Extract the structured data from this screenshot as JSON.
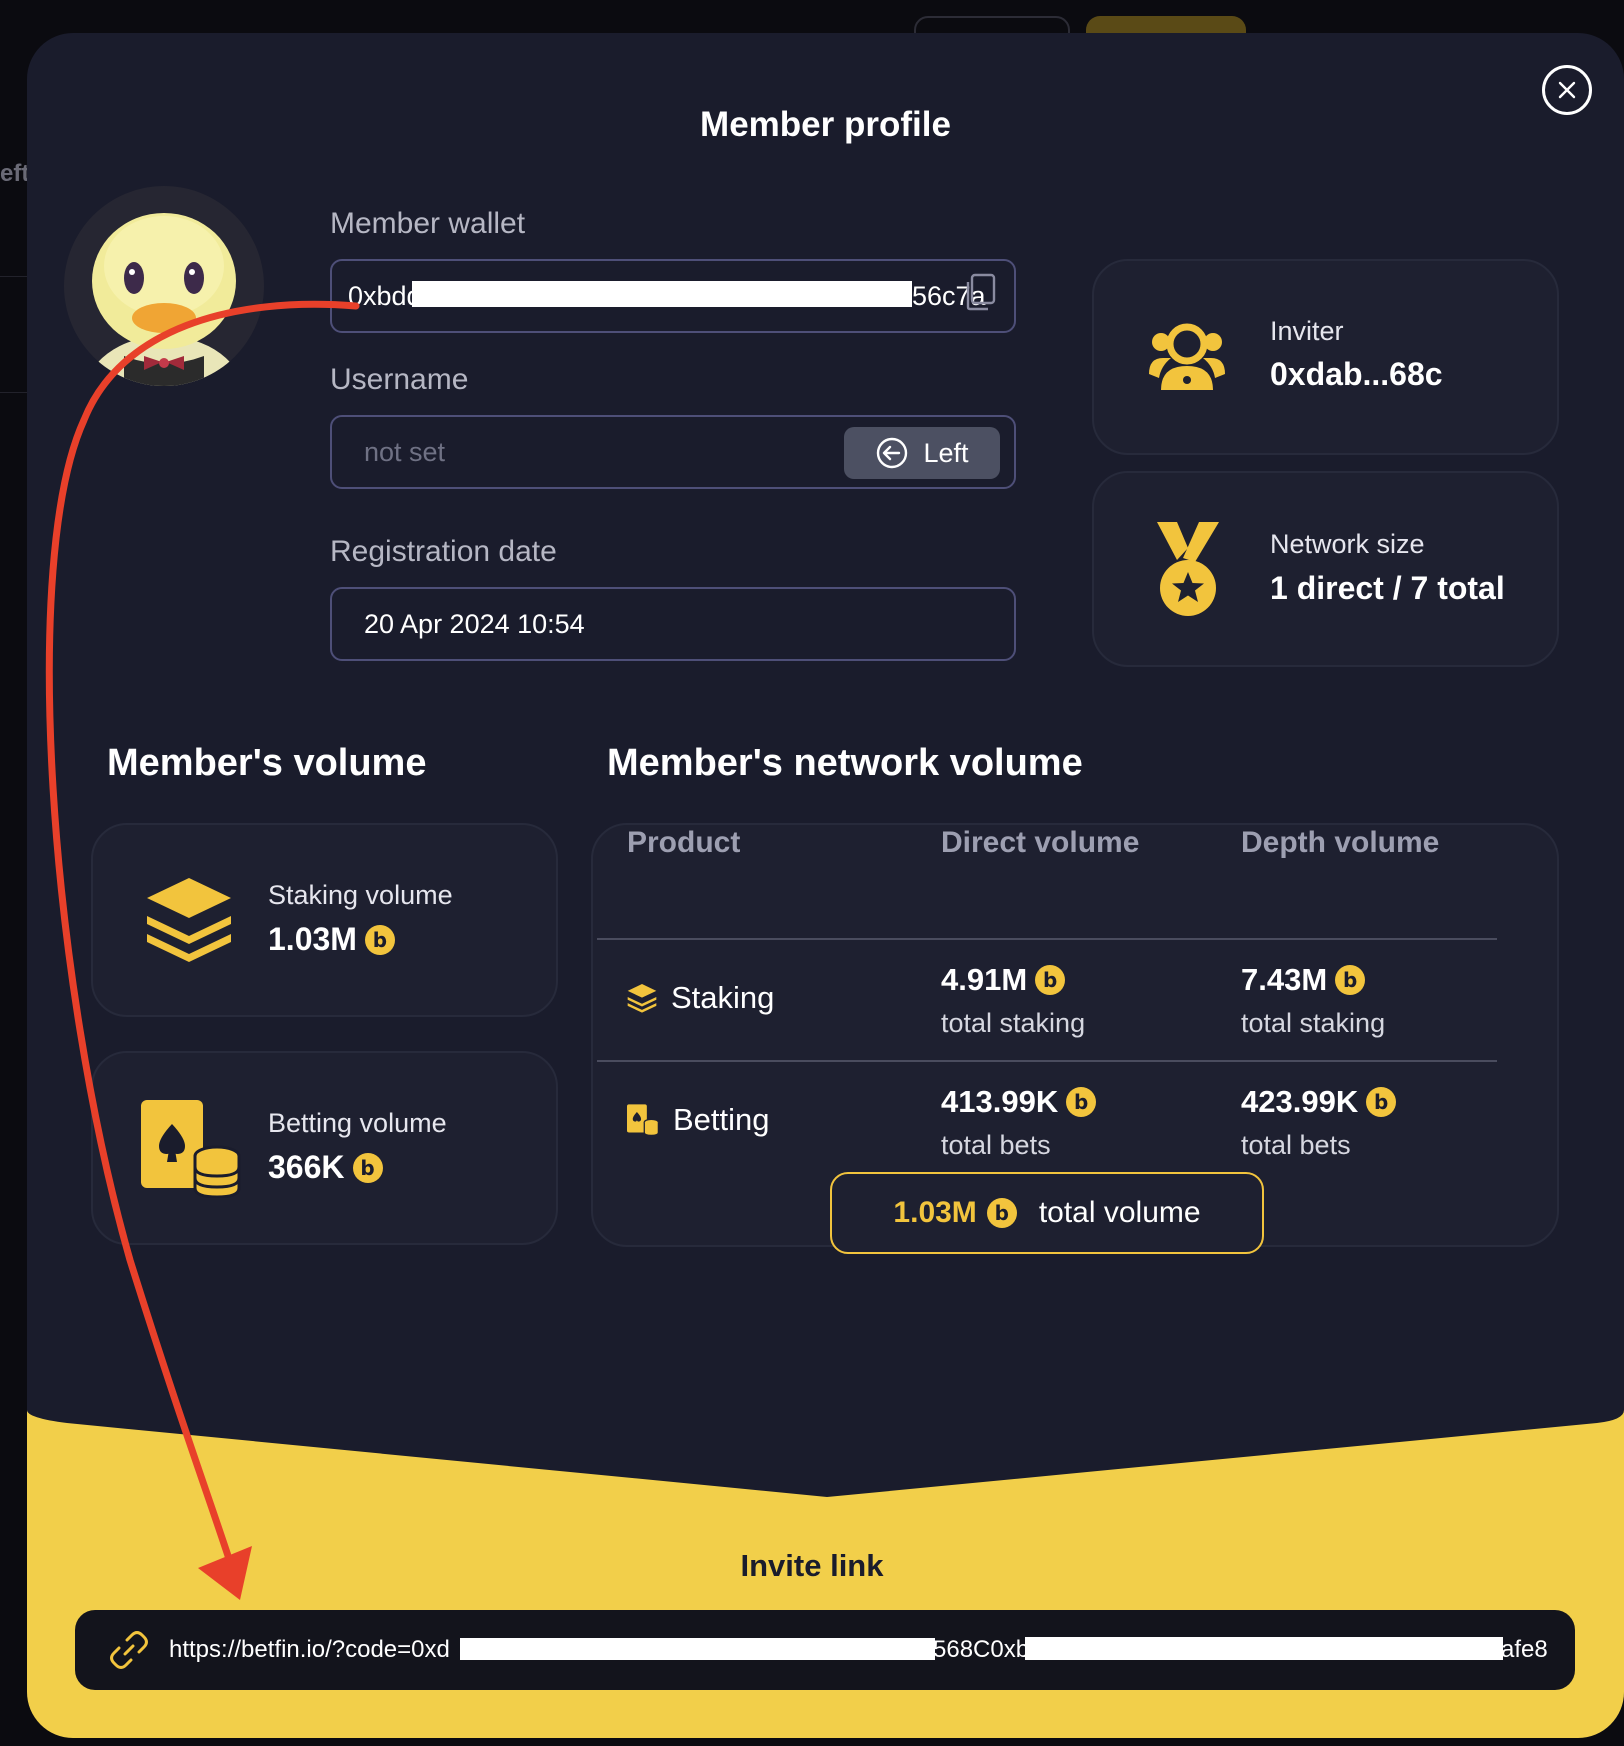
{
  "background": {
    "partial_text": "eft"
  },
  "modal": {
    "title": "Member profile",
    "close_icon": "close-icon"
  },
  "wallet": {
    "label": "Member wallet",
    "value_start": "0xbdd",
    "value_end": "56c7a"
  },
  "username": {
    "label": "Username",
    "placeholder": "not set",
    "button_label": "Left"
  },
  "registration": {
    "label": "Registration date",
    "value": "20 Apr 2024 10:54"
  },
  "inviter": {
    "label": "Inviter",
    "value": "0xdab...68c"
  },
  "network": {
    "label": "Network size",
    "value": "1 direct / 7 total"
  },
  "member_volume": {
    "title": "Member's volume",
    "staking": {
      "label": "Staking volume",
      "value": "1.03M"
    },
    "betting": {
      "label": "Betting volume",
      "value": "366K"
    }
  },
  "network_volume": {
    "title": "Member's network volume",
    "columns": [
      "Product",
      "Direct volume",
      "Depth volume"
    ],
    "rows": [
      {
        "product": "Staking",
        "direct": "4.91M",
        "direct_sub": "total staking",
        "depth": "7.43M",
        "depth_sub": "total staking"
      },
      {
        "product": "Betting",
        "direct": "413.99K",
        "direct_sub": "total bets",
        "depth": "423.99K",
        "depth_sub": "total bets"
      }
    ],
    "total_amount": "1.03M",
    "total_label": "total volume"
  },
  "coin_symbol": "b",
  "invite": {
    "title": "Invite link",
    "url_start": "https://betfin.io/?code=0xd",
    "url_mid": "568C0xb",
    "url_end": "afe8"
  },
  "colors": {
    "accent": "#f2c43d",
    "modal_bg": "#1a1c2c",
    "card_bg": "#1e2030",
    "annotation_arrow": "#e8402a"
  }
}
